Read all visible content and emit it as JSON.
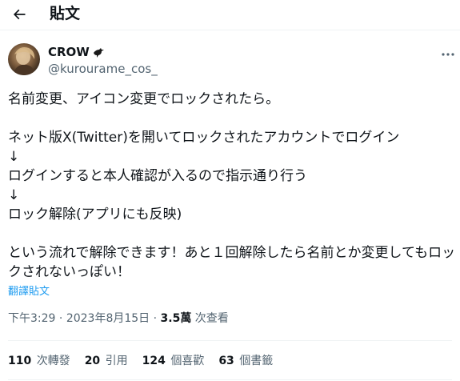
{
  "header": {
    "title": "貼文",
    "back_icon": "arrow-left-icon"
  },
  "author": {
    "name": "CROW",
    "name_emoji": "crow-bird-icon",
    "handle": "@kurourame_cos_"
  },
  "tweet": {
    "lines": [
      "名前変更、アイコン変更でロックされたら。",
      "",
      "ネット版X(Twitter)を開いてロックされたアカウントでログイン",
      "↓",
      "ログインすると本人確認が入るので指示通り行う",
      "↓",
      "ロック解除(アプリにも反映)",
      "",
      "という流れで解除できます！あと１回解除したら名前とか変更してもロッ",
      "クされないっぽい！"
    ],
    "translate_label": "翻譯貼文"
  },
  "meta": {
    "time": "下午3:29",
    "separator": "·",
    "date": "2023年8月15日",
    "views_count": "3.5萬",
    "views_label": "次查看"
  },
  "stats": [
    {
      "count": "110",
      "label": "次轉發"
    },
    {
      "count": "20",
      "label": "引用"
    },
    {
      "count": "124",
      "label": "個喜歡"
    },
    {
      "count": "63",
      "label": "個書籤"
    }
  ],
  "colors": {
    "text": "#0f1419",
    "secondary": "#536471",
    "link": "#1d9bf0",
    "divider": "#eff3f4"
  }
}
